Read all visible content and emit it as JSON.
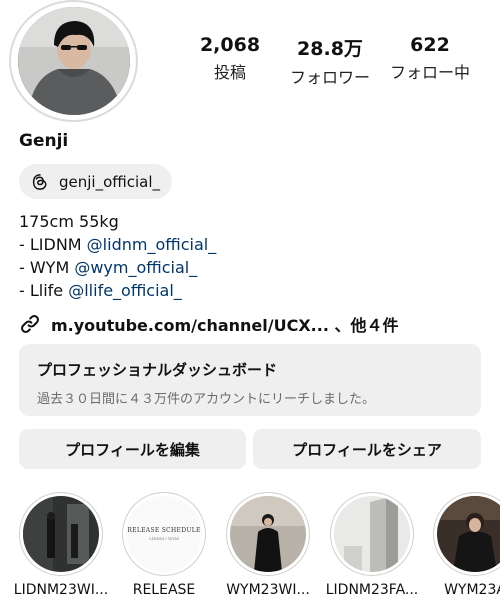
{
  "profile": {
    "stats": [
      {
        "value": "2,068",
        "label": "投稿"
      },
      {
        "value": "28.8万",
        "label": "フォロワー"
      },
      {
        "value": "622",
        "label": "フォロー中"
      }
    ],
    "name": "Genji",
    "threads_handle": "genji_official_",
    "bio": {
      "line1": "175cm 55kg",
      "line2_prefix": "- LIDNM ",
      "line2_mention": "@lidnm_official_",
      "line3_prefix": "- WYM ",
      "line3_mention": "@wym_official_",
      "line4_prefix": "- Llife ",
      "line4_mention": "@llife_official_"
    },
    "link_text": "m.youtube.com/channel/UCX... 、他４件"
  },
  "dashboard": {
    "title": "プロフェッショナルダッシュボード",
    "subtitle": "過去３０日間に４３万件のアカウントにリーチしました。"
  },
  "buttons": {
    "edit_label": "プロフィールを編集",
    "share_label": "プロフィールをシェア"
  },
  "highlights": [
    {
      "label": "LIDNM23WI..."
    },
    {
      "label": "RELEASE",
      "cover_title": "RELEASE SCHEDULE",
      "cover_sub": "LIDNM / WYM"
    },
    {
      "label": "WYM23WI..."
    },
    {
      "label": "LIDNM23FA..."
    },
    {
      "label": "WYM23A"
    }
  ],
  "colors": {
    "mention": "#00376b",
    "pill_bg": "#efefef"
  }
}
